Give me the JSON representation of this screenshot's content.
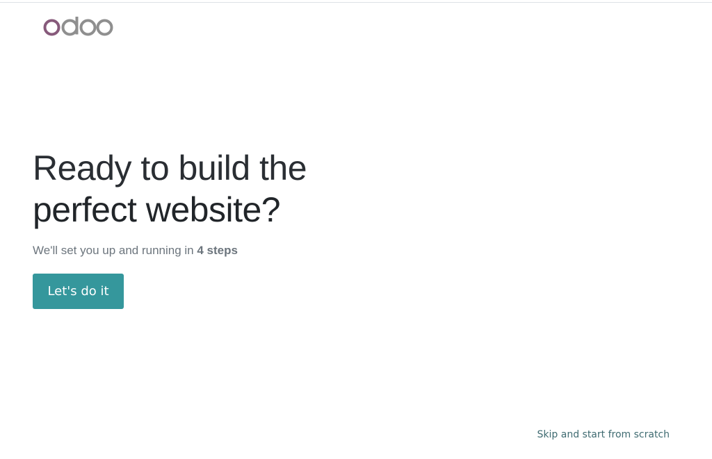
{
  "brand": {
    "logo_text": "odoo",
    "colors": {
      "logo_first_o": "#875A7B",
      "logo_rest": "#8F8F8F"
    }
  },
  "hero": {
    "headline_line1": "Ready to build the",
    "headline_line2": "perfect website?",
    "subtitle_prefix": "We'll set you up and running in",
    "subtitle_steps": "4 steps"
  },
  "actions": {
    "start_label": "Let's do it",
    "skip_label": "Skip and start from scratch"
  },
  "colors": {
    "primary_button": "#35979C",
    "link": "#3F6B71",
    "heading": "#212529",
    "muted_text": "#6C757D"
  }
}
